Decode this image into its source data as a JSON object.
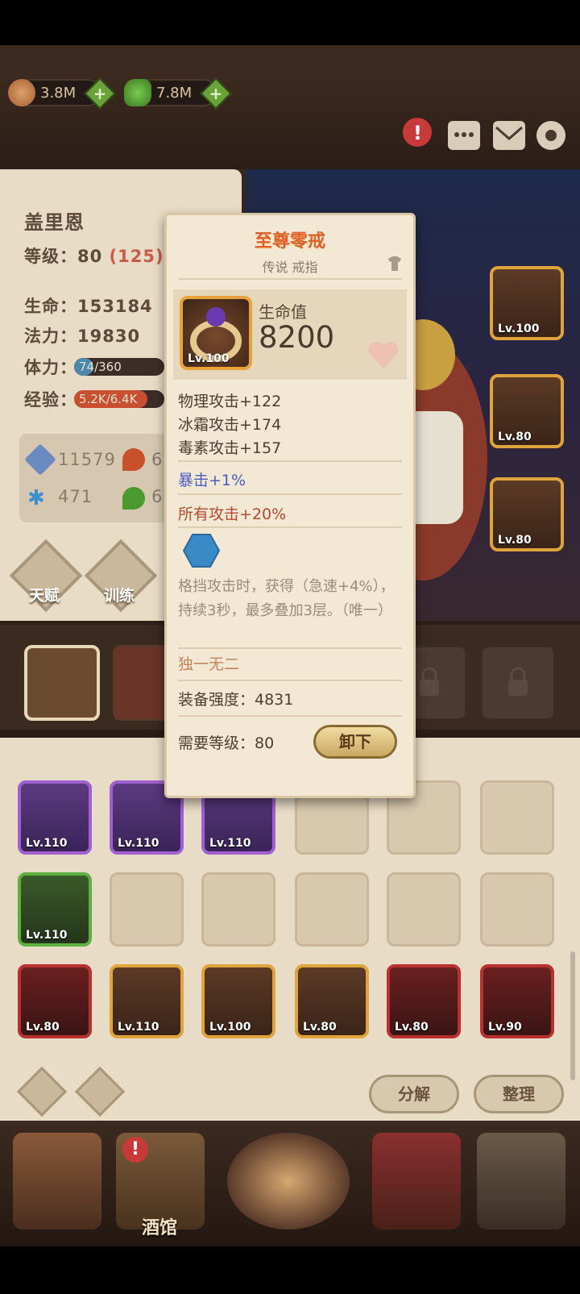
{
  "resources": {
    "bread": "3.8M",
    "leaf": "7.8M"
  },
  "top_icons": [
    "alert-icon",
    "chat-icon",
    "mail-icon",
    "gear-icon"
  ],
  "hero": {
    "name": "盖里恩",
    "level_label": "等级：",
    "level": "80",
    "level_extra": "(125)",
    "hp_label": "生命：",
    "hp": "153184",
    "mp_label": "法力：",
    "mp": "19830",
    "stamina_label": "体力：",
    "stamina": "74/360",
    "stamina_fraction": 0.21,
    "exp_label": "经验：",
    "exp": "5.2K/6.4K",
    "exp_fraction": 0.81,
    "attack": "11579",
    "fire_partial": "6",
    "frost": "471",
    "poison_partial": "6"
  },
  "skills": {
    "talent": "天赋",
    "training": "训练"
  },
  "tooltip": {
    "title": "至尊零戒",
    "subtitle": "传说 戒指",
    "icon_level": "Lv.100",
    "main_label": "生命值",
    "main_value": "8200",
    "stat1": "物理攻击+122",
    "stat2": "冰霜攻击+174",
    "stat3": "毒素攻击+157",
    "crit": "暴击+1%",
    "all_attack": "所有攻击+20%",
    "effect": "格挡攻击时，获得（急速+4%），持续3秒，最多叠加3层。（唯一）",
    "unique": "独一无二",
    "power": "装备强度：4831",
    "req_level": "需要等级：80",
    "unequip": "卸下"
  },
  "equipped_slots": [
    {
      "level": "Lv.100"
    },
    {
      "level": "Lv.80"
    },
    {
      "level": "Lv.80"
    }
  ],
  "inventory": {
    "row1": [
      "Lv.110",
      "Lv.110",
      "Lv.110"
    ],
    "row2": [
      "Lv.110"
    ],
    "row3": [
      "Lv.80",
      "Lv.110",
      "Lv.100",
      "Lv.80",
      "Lv.80",
      "Lv.90"
    ],
    "decompose": "分解",
    "sort": "整理"
  },
  "nav": {
    "tavern": "酒馆"
  },
  "colors": {
    "legendary_title": "#e0602a",
    "crit_blue": "#4a5cc4",
    "all_attack_red": "#b24a34",
    "gold_frame": "#e0a43c"
  }
}
